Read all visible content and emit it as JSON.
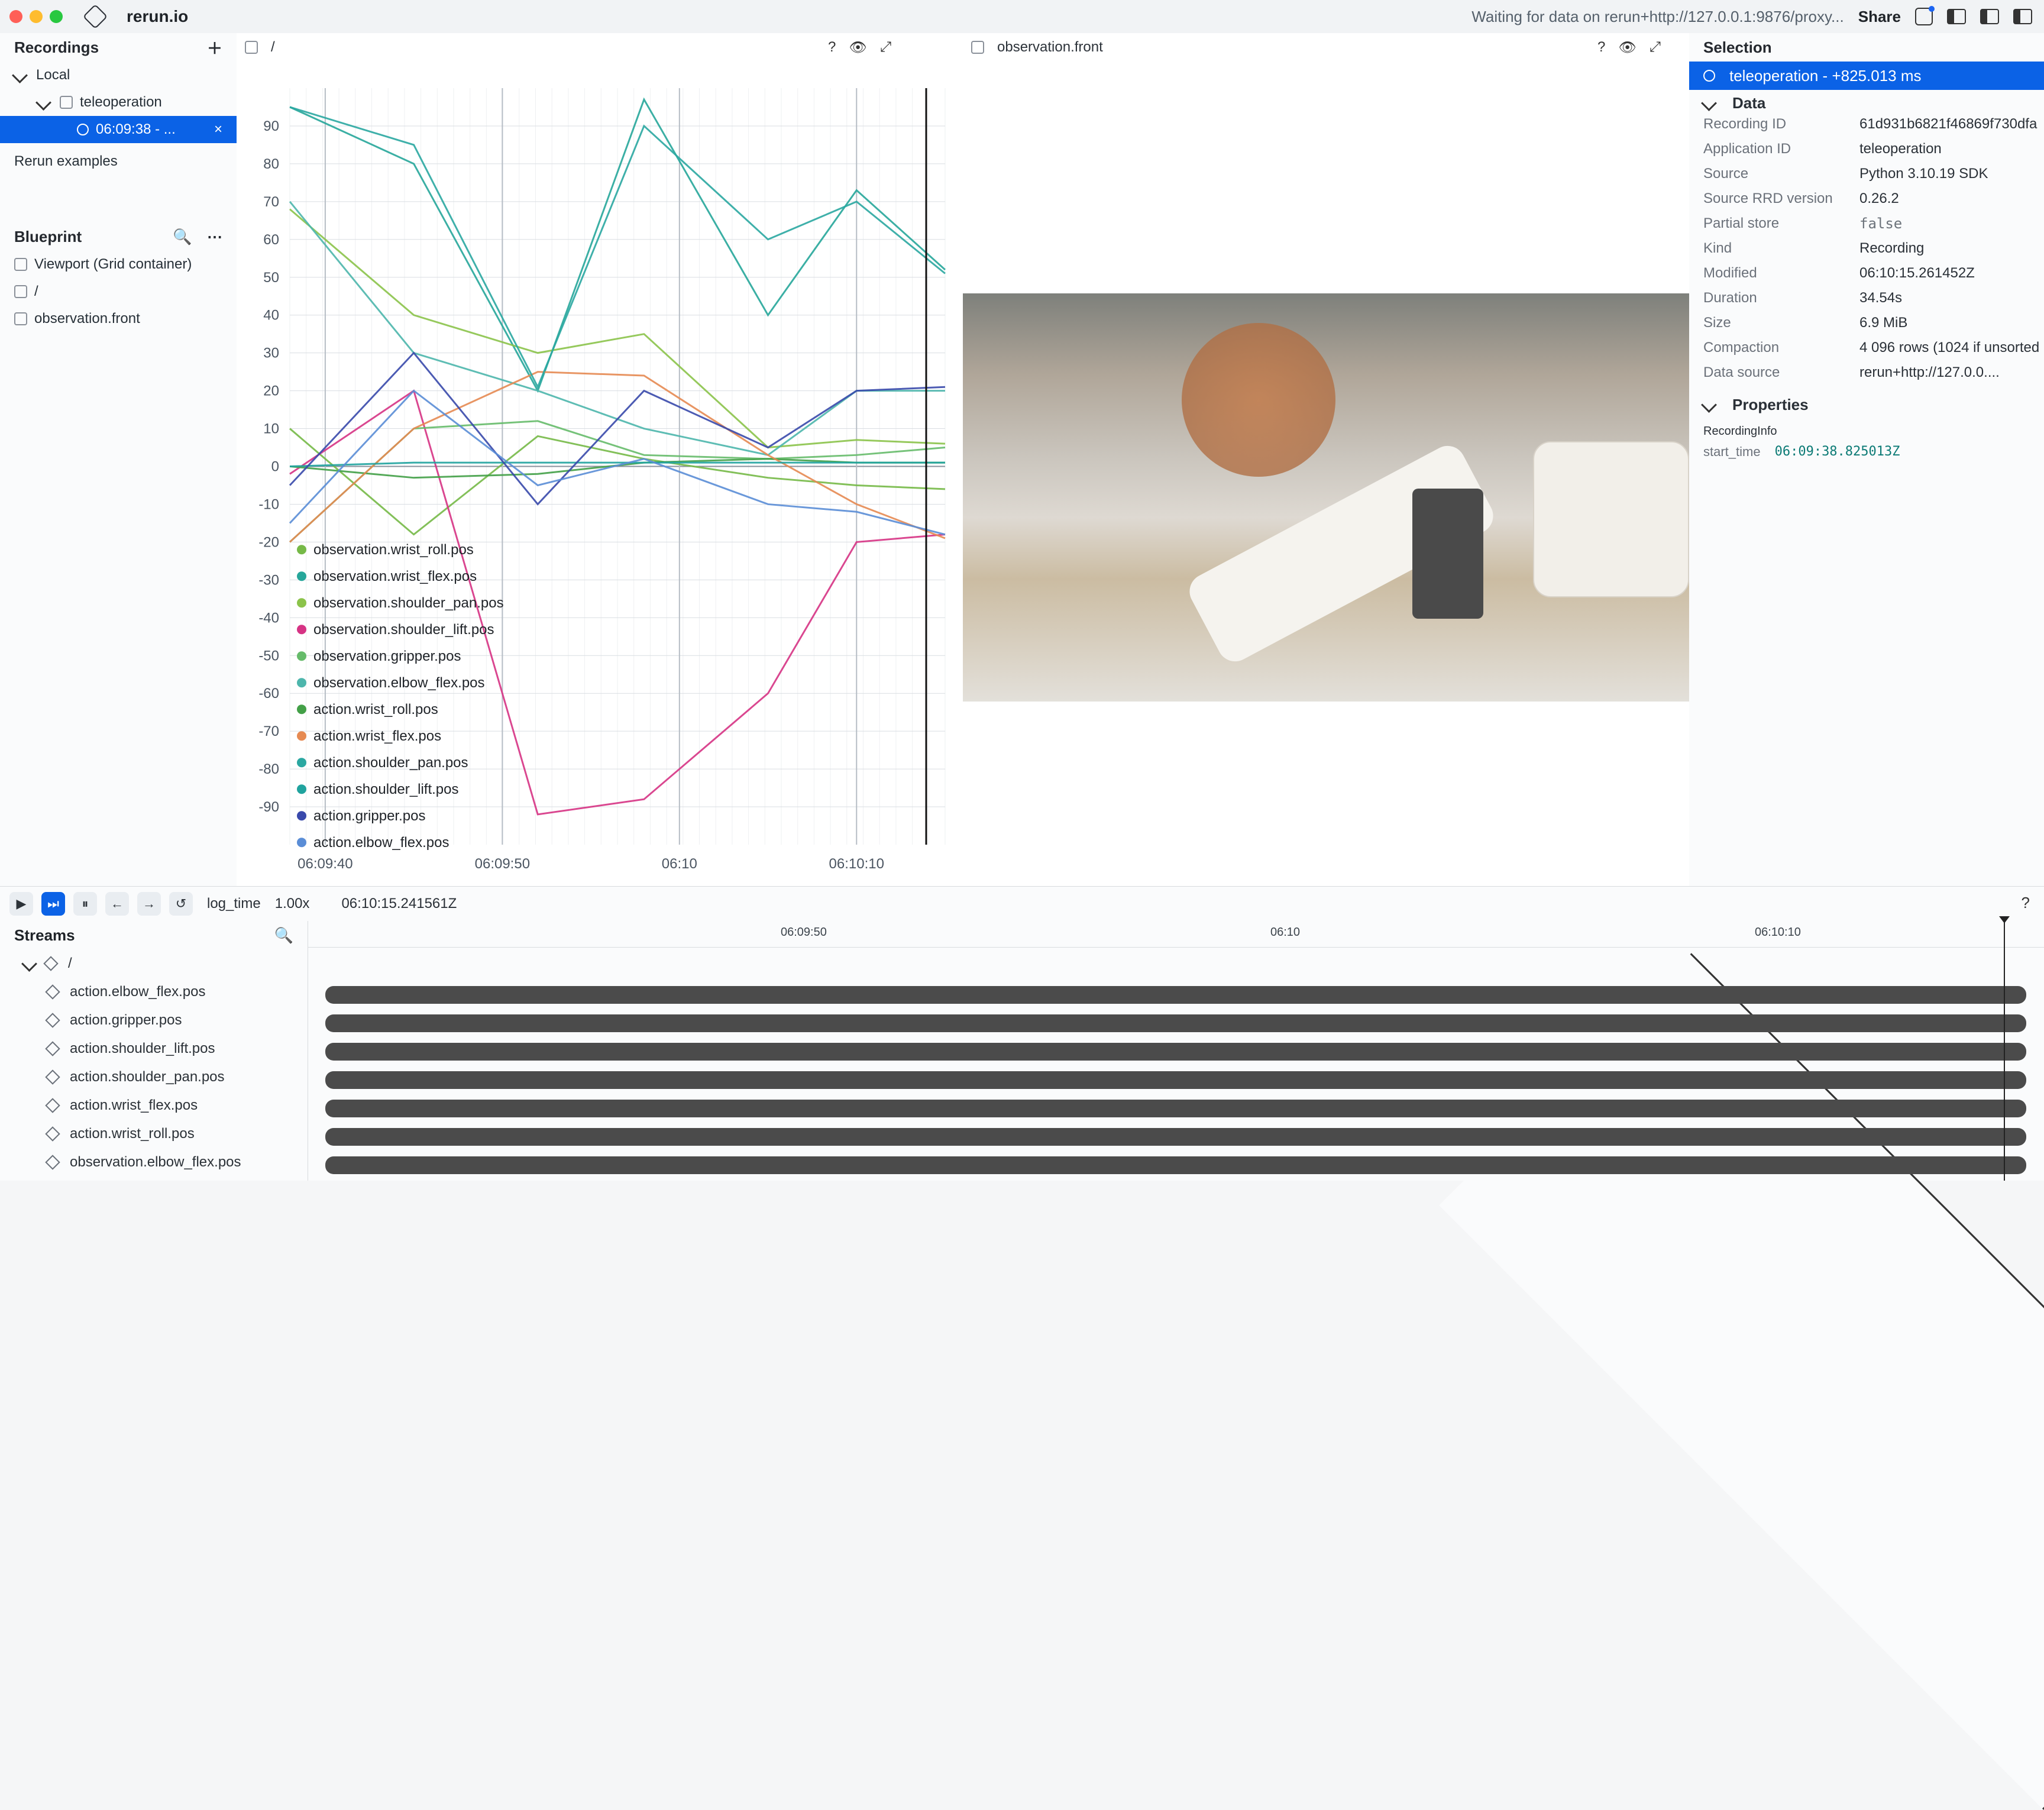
{
  "app": {
    "title": "rerun.io",
    "status": "Waiting for data on rerun+http://127.0.0.1:9876/proxy...",
    "share_label": "Share"
  },
  "left": {
    "recordings_label": "Recordings",
    "items": [
      {
        "label": "Local"
      },
      {
        "label": "teleoperation"
      },
      {
        "label": "06:09:38 - ..."
      }
    ],
    "examples_label": "Rerun examples",
    "blueprint_label": "Blueprint",
    "blueprint_items": [
      {
        "label": "Viewport (Grid container)"
      },
      {
        "label": "/"
      },
      {
        "label": "observation.front"
      }
    ]
  },
  "center": {
    "left_tab_label": "/",
    "right_tab_label": "observation.front"
  },
  "right": {
    "selection_label": "Selection",
    "selected_item": "teleoperation - +825.013 ms",
    "data_label": "Data",
    "data_rows": [
      {
        "k": "Recording ID",
        "v": "61d931b6821f46869f730dfa"
      },
      {
        "k": "Application ID",
        "v": "teleoperation"
      },
      {
        "k": "Source",
        "v": "Python 3.10.19 SDK"
      },
      {
        "k": "Source RRD version",
        "v": "0.26.2"
      },
      {
        "k": "Partial store",
        "v": "false"
      },
      {
        "k": "Kind",
        "v": "Recording"
      },
      {
        "k": "Modified",
        "v": "06:10:15.261452Z"
      },
      {
        "k": "Duration",
        "v": "34.54s"
      },
      {
        "k": "Size",
        "v": "6.9 MiB"
      },
      {
        "k": "Compaction",
        "v": "4 096 rows (1024 if unsorted"
      },
      {
        "k": "Data source",
        "v": "rerun+http://127.0.0...."
      }
    ],
    "properties_label": "Properties",
    "properties_group": "RecordingInfo",
    "properties": [
      {
        "k": "start_time",
        "v": "06:09:38.825013Z"
      }
    ]
  },
  "bottom": {
    "timeline_name": "log_time",
    "speed": "1.00x",
    "current_time": "06:10:15.241561Z",
    "streams_label": "Streams",
    "root_label": "/",
    "streams": [
      "action.elbow_flex.pos",
      "action.gripper.pos",
      "action.shoulder_lift.pos",
      "action.shoulder_pan.pos",
      "action.wrist_flex.pos",
      "action.wrist_roll.pos",
      "observation.elbow_flex.pos"
    ],
    "ticks": [
      "06:09:50",
      "06:10",
      "06:10:10"
    ]
  },
  "chart_data": {
    "type": "line",
    "title": "",
    "xlabel": "",
    "ylabel": "",
    "xlim": [
      "06:09:38",
      "06:10:15"
    ],
    "ylim": [
      -100,
      100
    ],
    "x_ticks": [
      "06:09:40",
      "06:09:50",
      "06:10",
      "06:10:10"
    ],
    "y_ticks": [
      90,
      80,
      70,
      60,
      50,
      40,
      30,
      20,
      10,
      0,
      -10,
      -20,
      -30,
      -40,
      -50,
      -60,
      -70,
      -80,
      -90
    ],
    "series": [
      {
        "name": "observation.wrist_roll.pos",
        "color": "#76b947",
        "x": [
          "06:09:38",
          "06:09:45",
          "06:09:52",
          "06:09:58",
          "06:10:05",
          "06:10:10",
          "06:10:15"
        ],
        "y": [
          10,
          -18,
          8,
          2,
          -3,
          -5,
          -6
        ]
      },
      {
        "name": "observation.wrist_flex.pos",
        "color": "#26a69a",
        "x": [
          "06:09:38",
          "06:09:45",
          "06:09:52",
          "06:09:58",
          "06:10:05",
          "06:10:10",
          "06:10:15"
        ],
        "y": [
          95,
          80,
          20,
          97,
          40,
          73,
          52
        ]
      },
      {
        "name": "observation.shoulder_pan.pos",
        "color": "#8bc34a",
        "x": [
          "06:09:38",
          "06:09:45",
          "06:09:52",
          "06:09:58",
          "06:10:05",
          "06:10:10",
          "06:10:15"
        ],
        "y": [
          68,
          40,
          30,
          35,
          5,
          7,
          6
        ]
      },
      {
        "name": "observation.shoulder_lift.pos",
        "color": "#d63384",
        "x": [
          "06:09:38",
          "06:09:45",
          "06:09:52",
          "06:09:58",
          "06:10:05",
          "06:10:10",
          "06:10:15"
        ],
        "y": [
          -2,
          20,
          -92,
          -88,
          -60,
          -20,
          -18
        ]
      },
      {
        "name": "observation.gripper.pos",
        "color": "#66bb6a",
        "x": [
          "06:09:38",
          "06:09:45",
          "06:09:52",
          "06:09:58",
          "06:10:05",
          "06:10:10",
          "06:10:15"
        ],
        "y": [
          -20,
          10,
          12,
          3,
          2,
          3,
          5
        ]
      },
      {
        "name": "observation.elbow_flex.pos",
        "color": "#4db6ac",
        "x": [
          "06:09:38",
          "06:09:45",
          "06:09:52",
          "06:09:58",
          "06:10:05",
          "06:10:10",
          "06:10:15"
        ],
        "y": [
          70,
          30,
          20,
          10,
          3,
          20,
          20
        ]
      },
      {
        "name": "action.wrist_roll.pos",
        "color": "#43a047",
        "x": [
          "06:09:38",
          "06:09:45",
          "06:09:52",
          "06:09:58",
          "06:10:05",
          "06:10:10",
          "06:10:15"
        ],
        "y": [
          0,
          -3,
          -2,
          1,
          2,
          1,
          1
        ]
      },
      {
        "name": "action.wrist_flex.pos",
        "color": "#e68a52",
        "x": [
          "06:09:38",
          "06:09:45",
          "06:09:52",
          "06:09:58",
          "06:10:05",
          "06:10:10",
          "06:10:15"
        ],
        "y": [
          -20,
          10,
          25,
          24,
          3,
          -10,
          -19
        ]
      },
      {
        "name": "action.shoulder_pan.pos",
        "color": "#2aa7a1",
        "x": [
          "06:09:38",
          "06:09:45",
          "06:09:52",
          "06:09:58",
          "06:10:05",
          "06:10:10",
          "06:10:15"
        ],
        "y": [
          95,
          85,
          21,
          90,
          60,
          70,
          51
        ]
      },
      {
        "name": "action.shoulder_lift.pos",
        "color": "#20a39e",
        "x": [
          "06:09:38",
          "06:09:45",
          "06:09:52",
          "06:09:58",
          "06:10:05",
          "06:10:10",
          "06:10:15"
        ],
        "y": [
          0,
          1,
          1,
          1,
          1,
          1,
          1
        ]
      },
      {
        "name": "action.gripper.pos",
        "color": "#3949ab",
        "x": [
          "06:09:38",
          "06:09:45",
          "06:09:52",
          "06:09:58",
          "06:10:05",
          "06:10:10",
          "06:10:15"
        ],
        "y": [
          -5,
          30,
          -10,
          20,
          5,
          20,
          21
        ]
      },
      {
        "name": "action.elbow_flex.pos",
        "color": "#5a8dd6",
        "x": [
          "06:09:38",
          "06:09:45",
          "06:09:52",
          "06:09:58",
          "06:10:05",
          "06:10:10",
          "06:10:15"
        ],
        "y": [
          -15,
          20,
          -5,
          2,
          -10,
          -12,
          -18
        ]
      }
    ]
  }
}
